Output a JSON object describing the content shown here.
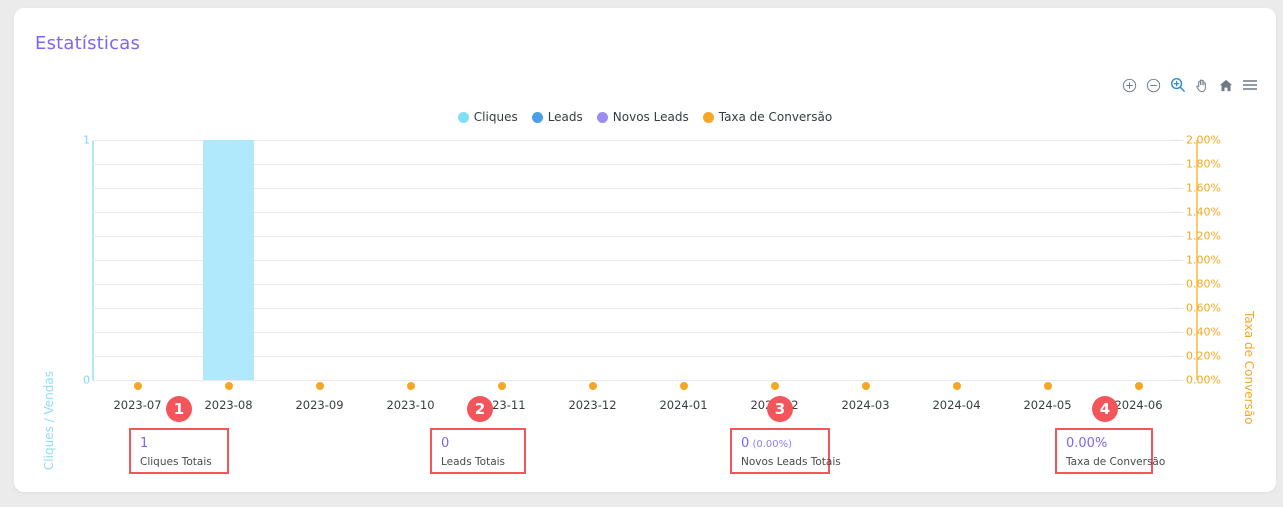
{
  "card": {
    "title": "Estatísticas"
  },
  "toolbar": {
    "items": [
      {
        "icon": "zoom-in-circle-icon",
        "name": "zoom-in-button",
        "active": false
      },
      {
        "icon": "zoom-out-circle-icon",
        "name": "zoom-out-button",
        "active": false
      },
      {
        "icon": "selection-zoom-icon",
        "name": "selection-zoom-button",
        "active": true
      },
      {
        "icon": "pan-hand-icon",
        "name": "panning-button",
        "active": false
      },
      {
        "icon": "home-icon",
        "name": "reset-zoom-button",
        "active": false
      },
      {
        "icon": "hamburger-menu-icon",
        "name": "menu-button",
        "active": false
      }
    ]
  },
  "chart_data": {
    "type": "bar",
    "title": "Estatísticas",
    "xlabel": "",
    "ylabel": "Cliques / Vendas",
    "y2label": "Taxa de Conversão",
    "categories": [
      "2023-07",
      "2023-08",
      "2023-09",
      "2023-10",
      "2023-11",
      "2023-12",
      "2024-01",
      "2024-02",
      "2024-03",
      "2024-04",
      "2024-05",
      "2024-06"
    ],
    "series": [
      {
        "name": "Cliques",
        "type": "bar",
        "color": "#7edff5",
        "bar_color": "#b0e9fb",
        "axis": "left",
        "values": [
          0,
          1,
          0,
          0,
          0,
          0,
          0,
          0,
          0,
          0,
          0,
          0
        ]
      },
      {
        "name": "Leads",
        "type": "bar",
        "color": "#4a9fe8",
        "axis": "left",
        "values": [
          0,
          0,
          0,
          0,
          0,
          0,
          0,
          0,
          0,
          0,
          0,
          0
        ]
      },
      {
        "name": "Novos Leads",
        "type": "bar",
        "color": "#9b8df0",
        "axis": "left",
        "values": [
          0,
          0,
          0,
          0,
          0,
          0,
          0,
          0,
          0,
          0,
          0,
          0
        ]
      },
      {
        "name": "Taxa de Conversão",
        "type": "scatter",
        "color": "#f5a623",
        "axis": "right",
        "values": [
          0,
          0,
          0,
          0,
          0,
          0,
          0,
          0,
          0,
          0,
          0,
          0
        ]
      }
    ],
    "ylim": [
      0,
      1
    ],
    "yticks": [
      "1",
      "0"
    ],
    "y2lim": [
      0,
      2
    ],
    "y2ticks": [
      "2.00%",
      "1.80%",
      "1.60%",
      "1.40%",
      "1.20%",
      "1.00%",
      "0.80%",
      "0.60%",
      "0.40%",
      "0.20%",
      "0.00%"
    ],
    "grid": true,
    "legend": "top"
  },
  "annotations": [
    {
      "badge": "1",
      "value": "1",
      "percent": "",
      "label": "Cliques Totais"
    },
    {
      "badge": "2",
      "value": "0",
      "percent": "",
      "label": "Leads Totais"
    },
    {
      "badge": "3",
      "value": "0",
      "percent": "(0.00%)",
      "label": "Novos Leads Totais"
    },
    {
      "badge": "4",
      "value": "0.00%",
      "percent": "",
      "label": "Taxa de Conversão"
    }
  ],
  "colors": {
    "accent": "#7b68ee",
    "annotation": "#f4555a",
    "conversion": "#f5a623",
    "clicks": "#7edff5"
  }
}
